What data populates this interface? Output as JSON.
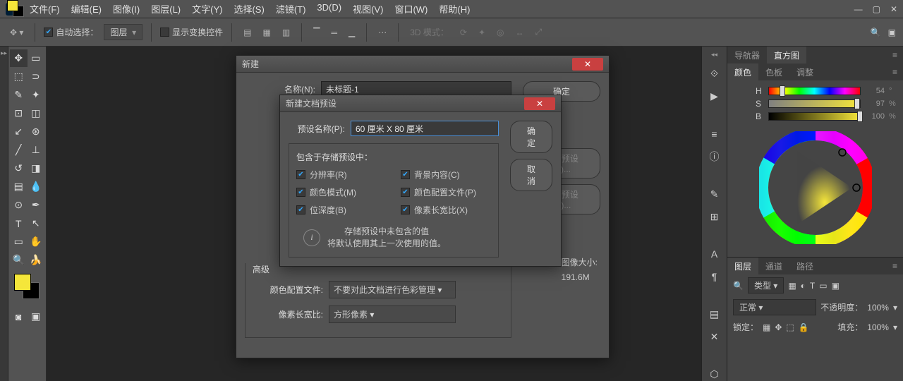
{
  "menubar": {
    "items": [
      "文件(F)",
      "编辑(E)",
      "图像(I)",
      "图层(L)",
      "文字(Y)",
      "选择(S)",
      "滤镜(T)",
      "3D(D)",
      "视图(V)",
      "窗口(W)",
      "帮助(H)"
    ]
  },
  "optionbar": {
    "auto_select": "自动选择：",
    "layer": "图层",
    "show_transform": "显示变换控件",
    "mode_3d": "3D 模式："
  },
  "panels": {
    "nav_tabs": [
      "导航器",
      "直方图"
    ],
    "color_tabs": [
      "颜色",
      "色板",
      "调整"
    ],
    "hsb": {
      "h": {
        "label": "H",
        "val": "54",
        "unit": "°"
      },
      "s": {
        "label": "S",
        "val": "97",
        "unit": "%"
      },
      "b": {
        "label": "B",
        "val": "100",
        "unit": "%"
      }
    },
    "layer_tabs": [
      "图层",
      "通道",
      "路径"
    ],
    "layer_kind": "类型",
    "blend_mode": "正常",
    "opacity_label": "不透明度：",
    "opacity_val": "100%",
    "lock_label": "锁定：",
    "fill_label": "填充：",
    "fill_val": "100%"
  },
  "dialog_new": {
    "title": "新建",
    "name_label": "名称(N):",
    "name_value": "未标题-1",
    "ok": "确定",
    "advanced": "高级",
    "color_profile_label": "颜色配置文件:",
    "color_profile_value": "不要对此文档进行色彩管理",
    "pixel_ratio_label": "像素长宽比:",
    "pixel_ratio_value": "方形像素",
    "image_size_label": "图像大小:",
    "image_size_value": "191.6M",
    "delete_preset": "删除预设(D)...",
    "save_preset_btn": "存储预设(S)..."
  },
  "dialog_preset": {
    "title": "新建文档预设",
    "preset_name_label": "预设名称(P):",
    "preset_name_value": "60 厘米 X 80 厘米",
    "ok": "确定",
    "cancel": "取消",
    "include_label": "包含于存储预设中：",
    "checks": [
      {
        "label": "分辨率(R)"
      },
      {
        "label": "背景内容(C)"
      },
      {
        "label": "颜色模式(M)"
      },
      {
        "label": "颜色配置文件(P)"
      },
      {
        "label": "位深度(B)"
      },
      {
        "label": "像素长宽比(X)"
      }
    ],
    "info1": "存储预设中未包含的值",
    "info2": "将默认使用其上一次使用的值。"
  }
}
